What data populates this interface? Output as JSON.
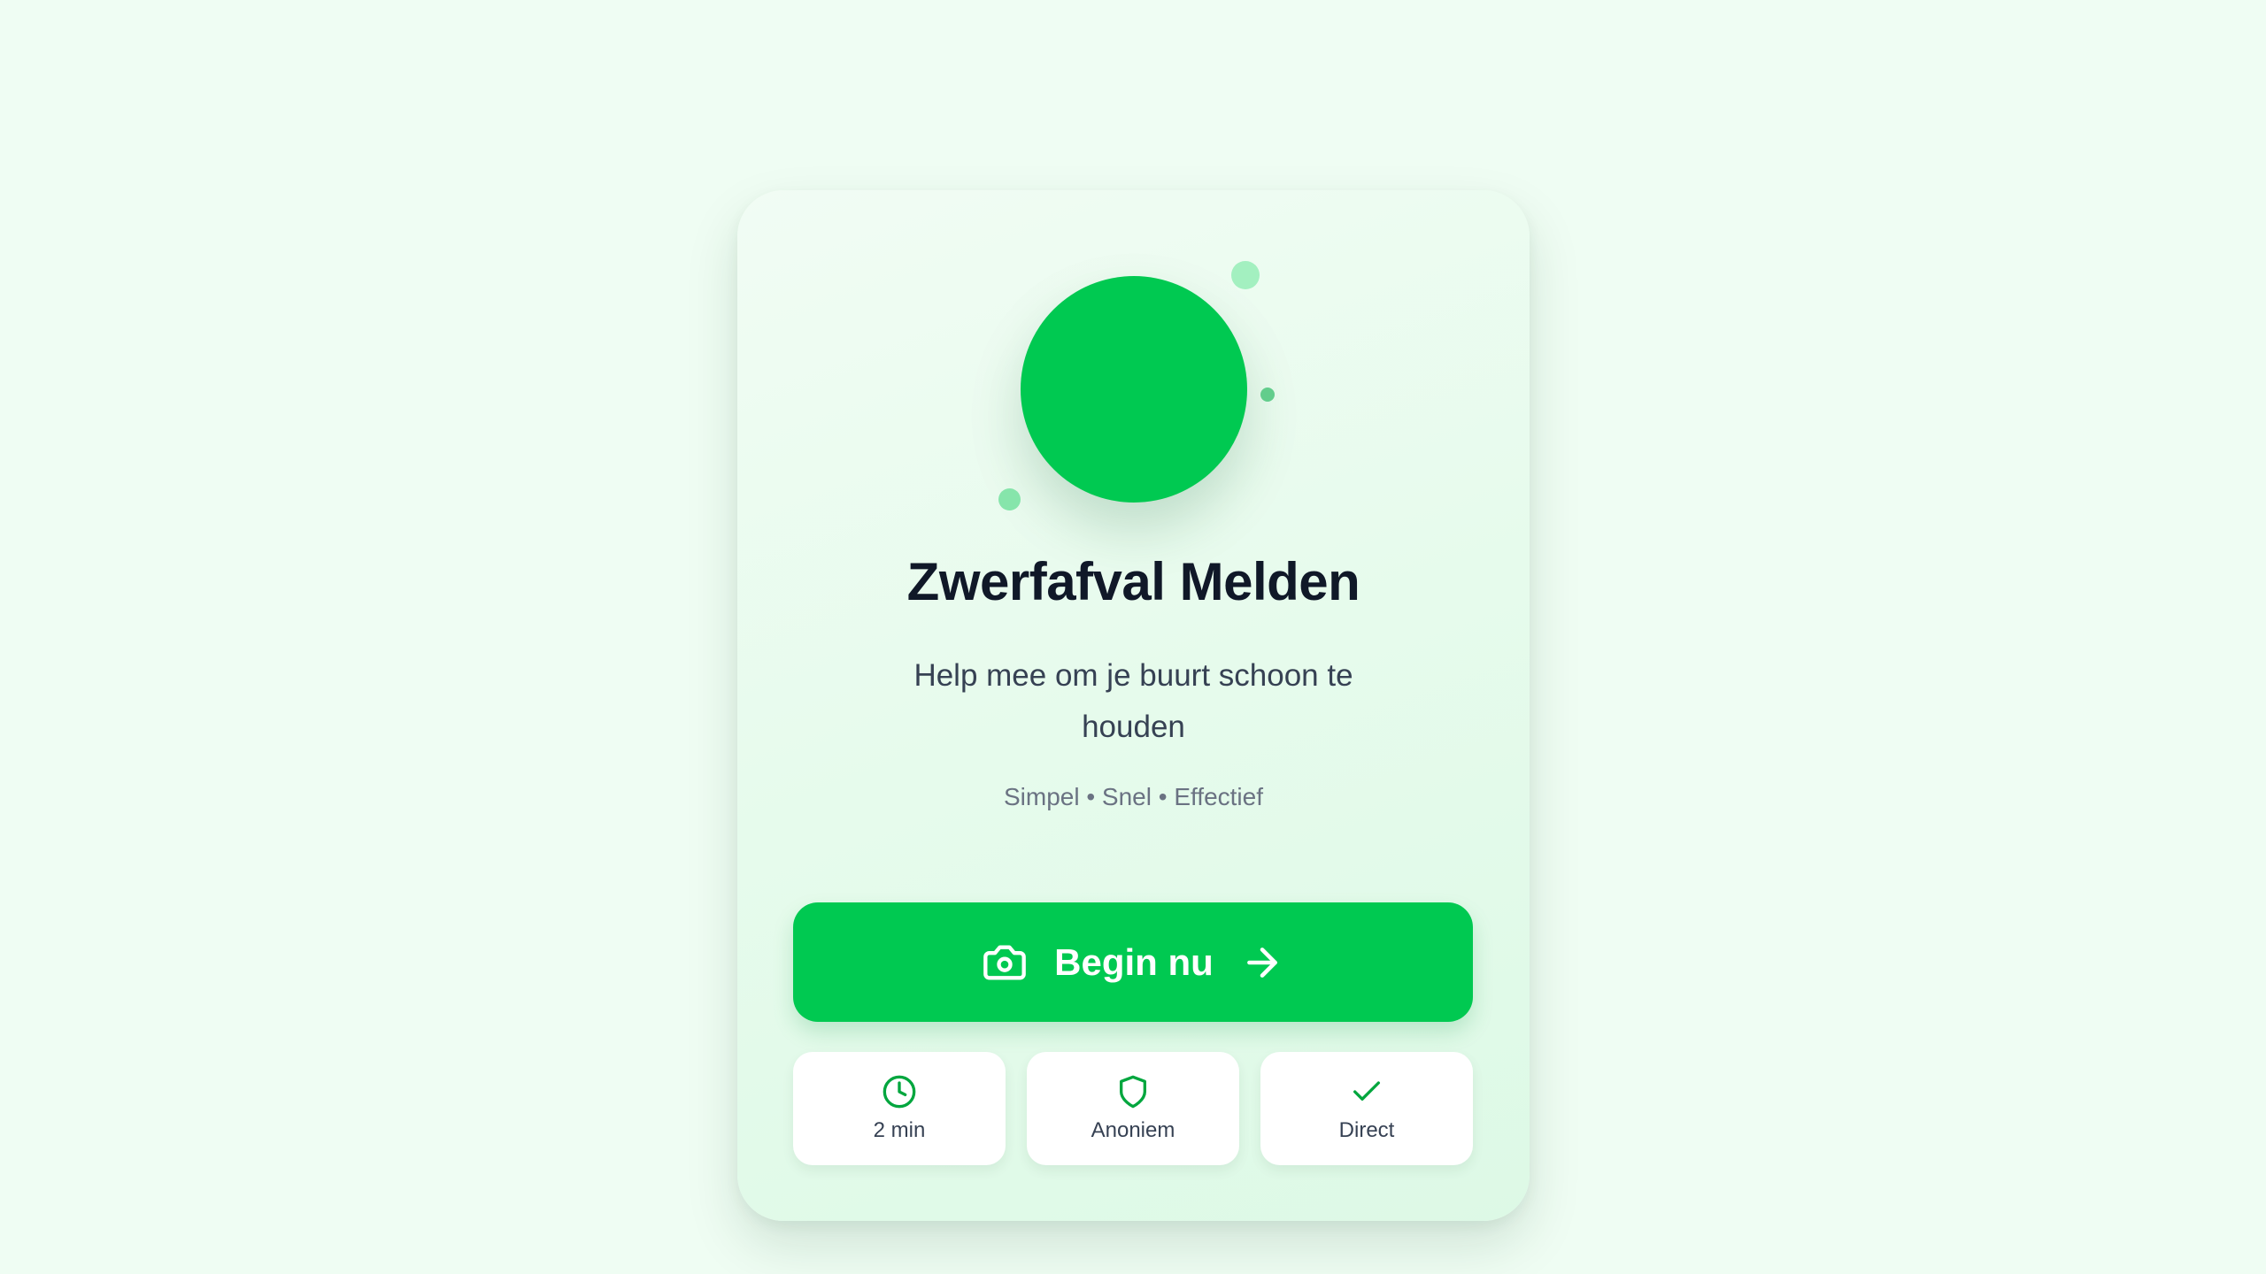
{
  "app": {
    "title": "Zwerfafval Melden",
    "subtitle": "Help mee om je buurt schoon te houden",
    "tagline": "Simpel • Snel • Effectief"
  },
  "cta": {
    "label": "Begin nu",
    "icon_left": "camera-icon",
    "icon_right": "arrow-right-icon"
  },
  "features": [
    {
      "label": "2 min",
      "icon": "clock-icon"
    },
    {
      "label": "Anoniem",
      "icon": "shield-icon"
    },
    {
      "label": "Direct",
      "icon": "check-icon"
    }
  ],
  "colors": {
    "page_background": "#effdf3",
    "accent": "#00c951",
    "title": "#101828",
    "body_text": "#364153",
    "muted_text": "#6a7282",
    "icon_green": "#00a63e"
  }
}
